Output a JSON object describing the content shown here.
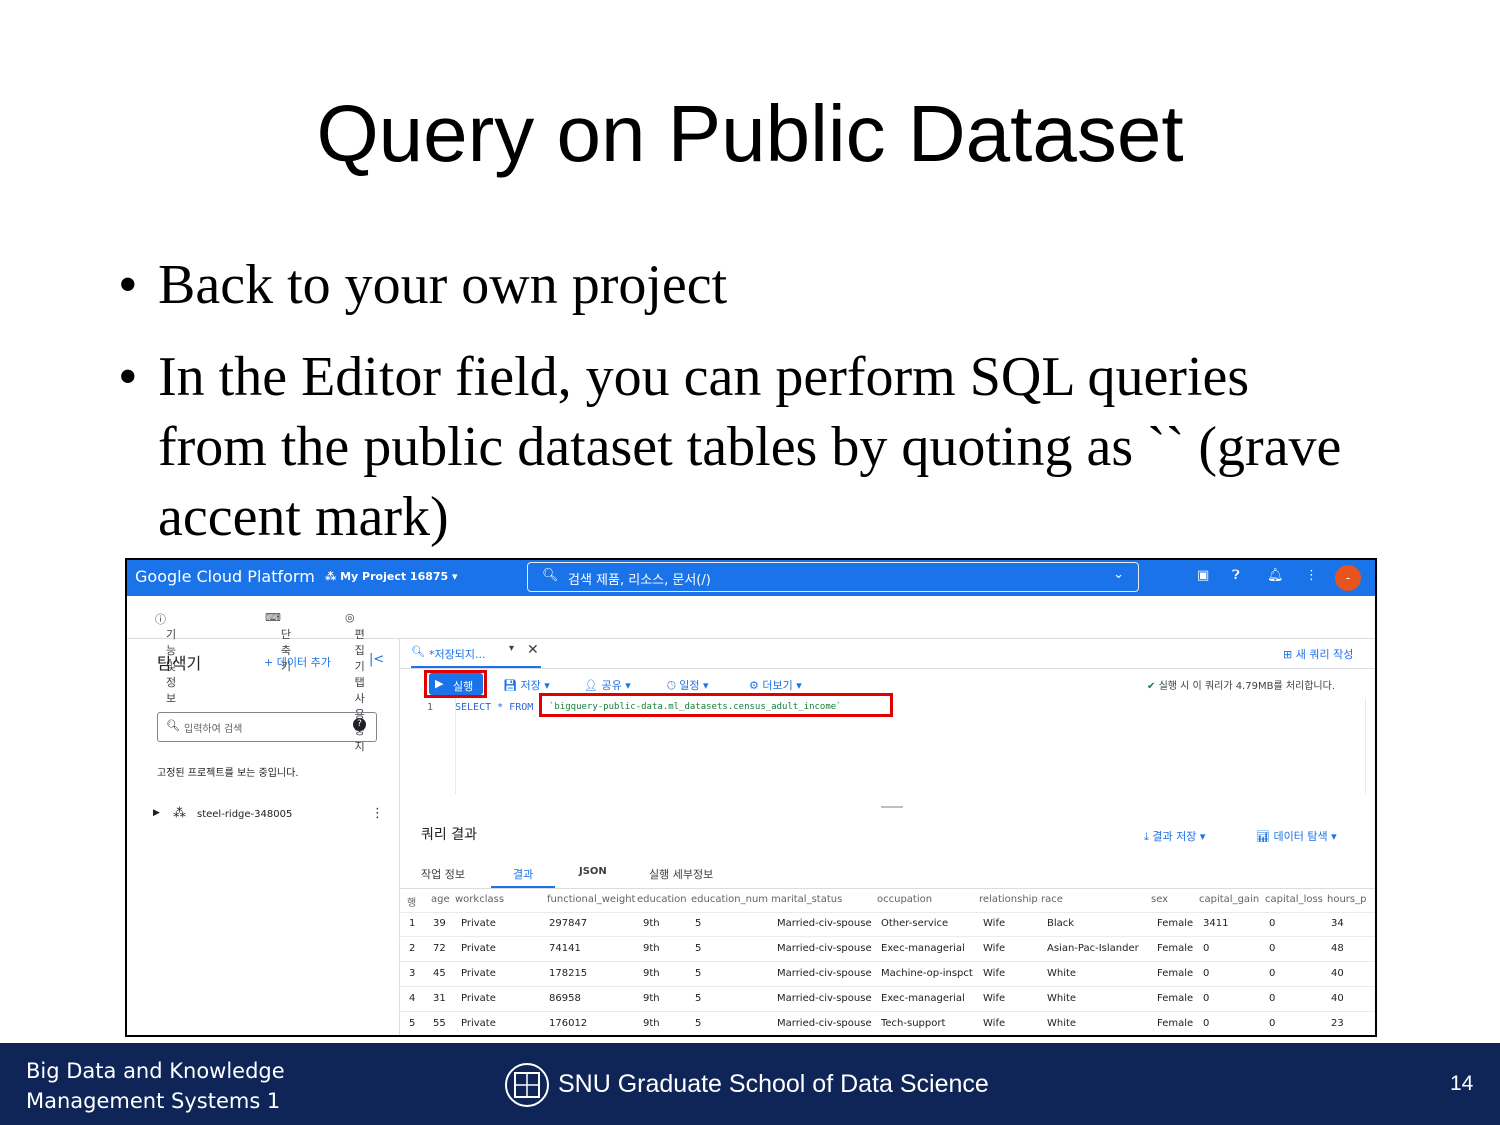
{
  "slide": {
    "title": "Query on Public Dataset",
    "bullets": [
      "Back to your own project",
      "In the Editor field, you can perform SQL queries from the public dataset tables by quoting as `` (grave accent mark)"
    ],
    "bullet_char": "•"
  },
  "gcp": {
    "brand": "Google Cloud Platform",
    "project": "My Project 16875",
    "search_text": "검색  제품, 리소스, 문서(/)",
    "avatar": "-",
    "subnav": [
      "기능 및 정보",
      "단축키",
      "편집기 탭 사용 중지"
    ]
  },
  "explorer": {
    "title": "탐색기",
    "add_data": "+ 데이터 추가",
    "collapse": "|<",
    "search_placeholder": "입력하여 검색",
    "help": "?",
    "pinned_note": "고정된 프로젝트를 보는 중입니다.",
    "project_item": "steel-ridge-348005"
  },
  "editor": {
    "tab_label": "*저장되지...",
    "new_query": "새 쿼리 작성",
    "run": "실행",
    "toolbar": [
      "저장",
      "공유",
      "일정",
      "더보기"
    ],
    "validation": "실행 시 이 쿼리가 4.79MB를 처리합니다.",
    "line_no": "1",
    "sql_select": "SELECT * FROM",
    "sql_table": "`bigquery-public-data.ml_datasets.census_adult_income`"
  },
  "results": {
    "title": "쿼리 결과",
    "save_results": "결과 저장",
    "explore_data": "데이터 탐색",
    "tabs": [
      "작업 정보",
      "결과",
      "JSON",
      "실행 세부정보"
    ],
    "columns": [
      "행",
      "age",
      "workclass",
      "functional_weight",
      "education",
      "education_num",
      "marital_status",
      "occupation",
      "relationship",
      "race",
      "sex",
      "capital_gain",
      "capital_loss",
      "hours_p"
    ],
    "rows": [
      [
        "1",
        "39",
        "Private",
        "297847",
        "9th",
        "5",
        "Married-civ-spouse",
        "Other-service",
        "Wife",
        "Black",
        "Female",
        "3411",
        "0",
        "34"
      ],
      [
        "2",
        "72",
        "Private",
        "74141",
        "9th",
        "5",
        "Married-civ-spouse",
        "Exec-managerial",
        "Wife",
        "Asian-Pac-Islander",
        "Female",
        "0",
        "0",
        "48"
      ],
      [
        "3",
        "45",
        "Private",
        "178215",
        "9th",
        "5",
        "Married-civ-spouse",
        "Machine-op-inspct",
        "Wife",
        "White",
        "Female",
        "0",
        "0",
        "40"
      ],
      [
        "4",
        "31",
        "Private",
        "86958",
        "9th",
        "5",
        "Married-civ-spouse",
        "Exec-managerial",
        "Wife",
        "White",
        "Female",
        "0",
        "0",
        "40"
      ],
      [
        "5",
        "55",
        "Private",
        "176012",
        "9th",
        "5",
        "Married-civ-spouse",
        "Tech-support",
        "Wife",
        "White",
        "Female",
        "0",
        "0",
        "23"
      ]
    ]
  },
  "footer": {
    "course_line1": "Big Data and Knowledge",
    "course_line2": "Management Systems 1",
    "school": "SNU Graduate School of Data Science",
    "page": "14"
  },
  "colors": {
    "gcp_blue": "#1a73e8",
    "footer_navy": "#0f2558",
    "highlight_red": "#e00000",
    "avatar_orange": "#e8541e"
  }
}
